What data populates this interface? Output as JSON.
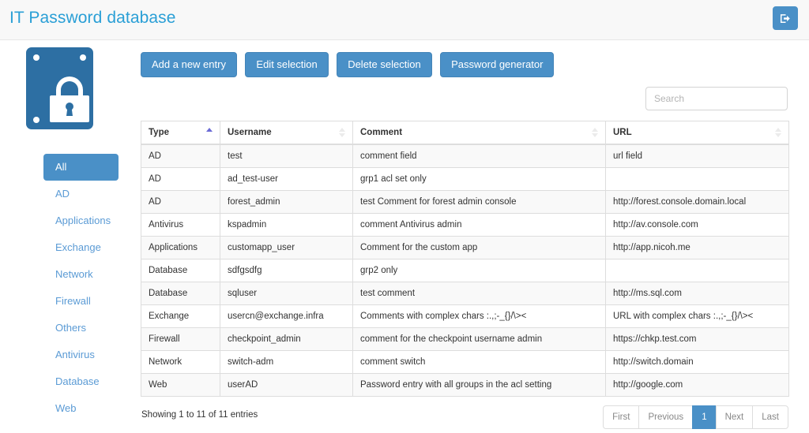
{
  "header": {
    "brand": "IT Password database",
    "logout_icon": "sign-out-icon",
    "brand_color": "#2a9fd6"
  },
  "sidebar": {
    "logo_icon": "padlock-database-logo",
    "items": [
      {
        "label": "All",
        "active": true
      },
      {
        "label": "AD",
        "active": false
      },
      {
        "label": "Applications",
        "active": false
      },
      {
        "label": "Exchange",
        "active": false
      },
      {
        "label": "Network",
        "active": false
      },
      {
        "label": "Firewall",
        "active": false
      },
      {
        "label": "Others",
        "active": false
      },
      {
        "label": "Antivirus",
        "active": false
      },
      {
        "label": "Database",
        "active": false
      },
      {
        "label": "Web",
        "active": false
      }
    ]
  },
  "toolbar": {
    "add_label": "Add a new entry",
    "edit_label": "Edit selection",
    "delete_label": "Delete selection",
    "generator_label": "Password generator"
  },
  "search": {
    "placeholder": "Search",
    "value": ""
  },
  "table": {
    "columns": [
      {
        "label": "Type",
        "sorted": "asc"
      },
      {
        "label": "Username",
        "sorted": "none"
      },
      {
        "label": "Comment",
        "sorted": "none"
      },
      {
        "label": "URL",
        "sorted": "none"
      }
    ],
    "rows": [
      {
        "type": "AD",
        "username": "test",
        "comment": "comment field",
        "url": "url field"
      },
      {
        "type": "AD",
        "username": "ad_test-user",
        "comment": "grp1 acl set only",
        "url": ""
      },
      {
        "type": "AD",
        "username": "forest_admin",
        "comment": "test Comment for forest admin console",
        "url": "http://forest.console.domain.local"
      },
      {
        "type": "Antivirus",
        "username": "kspadmin",
        "comment": "comment Antivirus admin",
        "url": "http://av.console.com"
      },
      {
        "type": "Applications",
        "username": "customapp_user",
        "comment": "Comment for the custom app",
        "url": "http://app.nicoh.me"
      },
      {
        "type": "Database",
        "username": "sdfgsdfg",
        "comment": "grp2 only",
        "url": ""
      },
      {
        "type": "Database",
        "username": "sqluser",
        "comment": "test comment",
        "url": "http://ms.sql.com"
      },
      {
        "type": "Exchange",
        "username": "usercn@exchange.infra",
        "comment": "Comments with complex chars :.,;-_{}/\\><",
        "url": "URL with complex chars :.,;-_{}/\\><"
      },
      {
        "type": "Firewall",
        "username": "checkpoint_admin",
        "comment": "comment for the checkpoint username admin",
        "url": "https://chkp.test.com"
      },
      {
        "type": "Network",
        "username": "switch-adm",
        "comment": "comment switch",
        "url": "http://switch.domain"
      },
      {
        "type": "Web",
        "username": "userAD",
        "comment": "Password entry with all groups in the acl setting",
        "url": "http://google.com"
      }
    ]
  },
  "footer": {
    "showing": "Showing 1 to 11 of 11 entries",
    "pagination": [
      {
        "label": "First",
        "active": false
      },
      {
        "label": "Previous",
        "active": false
      },
      {
        "label": "1",
        "active": true
      },
      {
        "label": "Next",
        "active": false
      },
      {
        "label": "Last",
        "active": false
      }
    ]
  },
  "colors": {
    "accent": "#4a90c7",
    "brand": "#2a9fd6",
    "logo": "#2d6fa3",
    "navbar_bg": "#f8f8f8",
    "row_stripe": "#f9f9f9"
  }
}
